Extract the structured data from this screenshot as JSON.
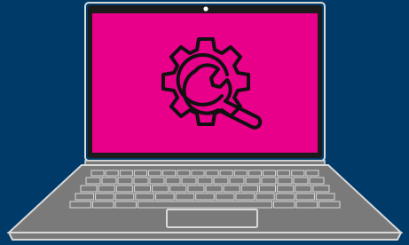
{
  "colors": {
    "background": "#003a68",
    "screen": "#e8008a",
    "icon_stroke": "#111111",
    "laptop_body": "#7a7a7a",
    "laptop_outline": "#d9d9d9",
    "bezel": "#1b1b1b"
  },
  "illustration": {
    "subject": "laptop",
    "screen_icon": "gear-wrench-icon"
  }
}
